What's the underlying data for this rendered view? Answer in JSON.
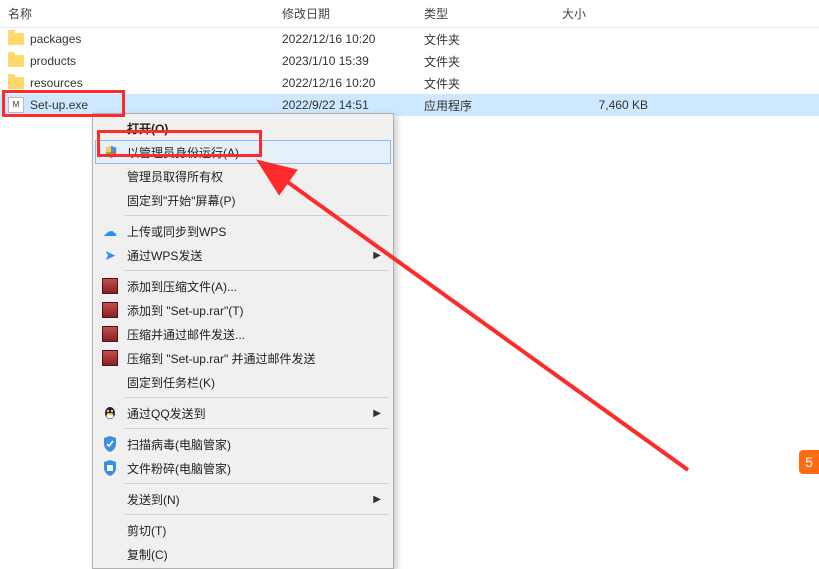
{
  "columns": {
    "name": "名称",
    "date": "修改日期",
    "type": "类型",
    "size": "大小"
  },
  "files": [
    {
      "name": "packages",
      "date": "2022/12/16 10:20",
      "type": "文件夹",
      "size": "",
      "icon": "folder"
    },
    {
      "name": "products",
      "date": "2023/1/10 15:39",
      "type": "文件夹",
      "size": "",
      "icon": "folder"
    },
    {
      "name": "resources",
      "date": "2022/12/16 10:20",
      "type": "文件夹",
      "size": "",
      "icon": "folder"
    },
    {
      "name": "Set-up.exe",
      "date": "2022/9/22 14:51",
      "type": "应用程序",
      "size": "7,460 KB",
      "icon": "exe"
    }
  ],
  "menu": {
    "open": "打开(O)",
    "run_as_admin": "以管理员身份运行(A)",
    "admin_own": "管理员取得所有权",
    "pin_start": "固定到\"开始\"屏幕(P)",
    "upload_wps": "上传或同步到WPS",
    "send_wps": "通过WPS发送",
    "add_archive": "添加到压缩文件(A)...",
    "add_to_setup": "添加到 \"Set-up.rar\"(T)",
    "compress_email": "压缩并通过邮件发送...",
    "compress_setup_email": "压缩到 \"Set-up.rar\" 并通过邮件发送",
    "pin_taskbar": "固定到任务栏(K)",
    "send_qq": "通过QQ发送到",
    "scan_virus": "扫描病毒(电脑管家)",
    "shred": "文件粉碎(电脑管家)",
    "send_to": "发送到(N)",
    "cut": "剪切(T)",
    "copy": "复制(C)"
  }
}
